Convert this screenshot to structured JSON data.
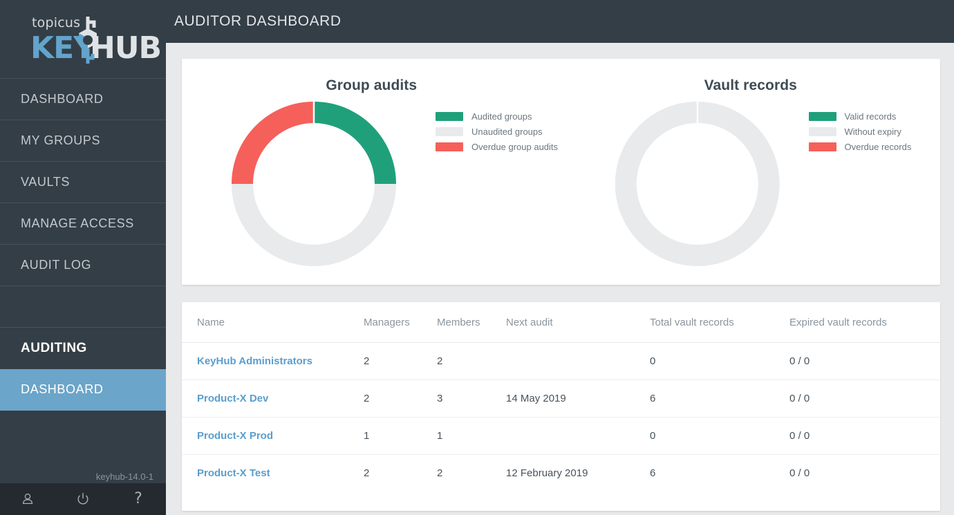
{
  "brand": {
    "logo_top": "topicus",
    "logo_key": "KEY",
    "logo_hub": "HUB",
    "accent_blue": "#62a4cc",
    "sidebar_bg": "#343e46"
  },
  "header": {
    "title": "AUDITOR DASHBOARD"
  },
  "sidebar": {
    "items": [
      {
        "label": "DASHBOARD",
        "active": false
      },
      {
        "label": "MY GROUPS",
        "active": false
      },
      {
        "label": "VAULTS",
        "active": false
      },
      {
        "label": "MANAGE ACCESS",
        "active": false
      },
      {
        "label": "AUDIT LOG",
        "active": false
      }
    ],
    "section_title": "AUDITING",
    "section_items": [
      {
        "label": "DASHBOARD",
        "active": true
      }
    ],
    "version": "keyhub-14.0-1",
    "footer_icons": [
      {
        "name": "user-icon"
      },
      {
        "name": "power-icon"
      },
      {
        "name": "help-icon",
        "glyph": "?"
      }
    ]
  },
  "chart_data": [
    {
      "type": "pie",
      "variant": "donut",
      "title": "Group audits",
      "categories": [
        "Audited groups",
        "Unaudited groups",
        "Overdue group audits"
      ],
      "values": [
        25,
        50,
        25
      ],
      "colors": [
        "#1fa07b",
        "#e8eaeb",
        "#f5605a"
      ],
      "legend_position": "right",
      "start_angle": 0,
      "hole_ratio": 0.74
    },
    {
      "type": "pie",
      "variant": "donut",
      "title": "Vault records",
      "categories": [
        "Valid records",
        "Without expiry",
        "Overdue records"
      ],
      "values": [
        0,
        100,
        0
      ],
      "colors": [
        "#1fa07b",
        "#e8eaeb",
        "#f5605a"
      ],
      "legend_position": "right",
      "start_angle": 0,
      "hole_ratio": 0.74
    }
  ],
  "table": {
    "columns": [
      "Name",
      "Managers",
      "Members",
      "Next audit",
      "Total vault records",
      "Expired vault records"
    ],
    "rows": [
      {
        "name": "KeyHub Administrators",
        "managers": "2",
        "members": "2",
        "next_audit": "",
        "next_audit_overdue": false,
        "total_vault_records": "0",
        "expired_vault_records": "0 / 0"
      },
      {
        "name": "Product-X Dev",
        "managers": "2",
        "members": "3",
        "next_audit": "14 May 2019",
        "next_audit_overdue": false,
        "total_vault_records": "6",
        "expired_vault_records": "0 / 0"
      },
      {
        "name": "Product-X Prod",
        "managers": "1",
        "members": "1",
        "next_audit": "",
        "next_audit_overdue": false,
        "total_vault_records": "0",
        "expired_vault_records": "0 / 0"
      },
      {
        "name": "Product-X Test",
        "managers": "2",
        "members": "2",
        "next_audit": "12 February 2019",
        "next_audit_overdue": true,
        "total_vault_records": "6",
        "expired_vault_records": "0 / 0"
      }
    ]
  }
}
